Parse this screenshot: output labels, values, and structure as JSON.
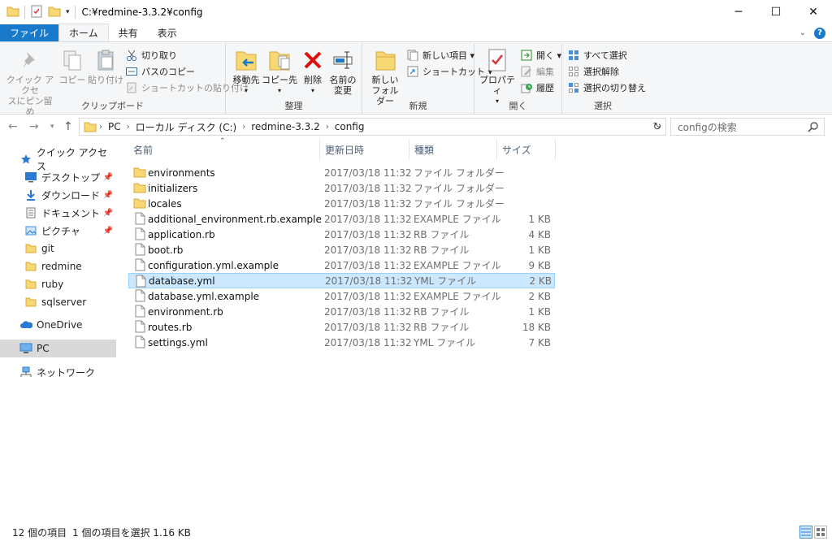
{
  "window": {
    "title": "C:¥redmine-3.3.2¥config",
    "minimize_label": "─",
    "maximize_label": "☐",
    "close_label": "✕"
  },
  "ribbon_tabs": [
    {
      "label": "ファイル"
    },
    {
      "label": "ホーム"
    },
    {
      "label": "共有"
    },
    {
      "label": "表示"
    }
  ],
  "ribbon": {
    "clipboard": {
      "label": "クリップボード",
      "pin_line1": "クイック アクセ",
      "pin_line2": "スにピン留め",
      "copy": "コピー",
      "paste": "貼り付け",
      "cut": "切り取り",
      "copy_path": "パスのコピー",
      "paste_shortcut": "ショートカットの貼り付け"
    },
    "organize": {
      "label": "整理",
      "move_to": "移動先",
      "copy_to": "コピー先",
      "delete": "削除",
      "rename_line1": "名前の",
      "rename_line2": "変更"
    },
    "new": {
      "label": "新規",
      "new_folder_line1": "新しい",
      "new_folder_line2": "フォルダー",
      "new_item": "新しい項目 ▾",
      "shortcut": "ショートカット ▾"
    },
    "open": {
      "label": "開く",
      "properties": "プロパティ",
      "open": "開く ▾",
      "edit": "編集",
      "history": "履歴"
    },
    "select": {
      "label": "選択",
      "select_all": "すべて選択",
      "select_none": "選択解除",
      "invert": "選択の切り替え"
    }
  },
  "address": {
    "crumbs": [
      "PC",
      "ローカル ディスク (C:)",
      "redmine-3.3.2",
      "config"
    ],
    "search_placeholder": "configの検索"
  },
  "nav": {
    "quick_access": "クイック アクセス",
    "items": [
      {
        "label": "デスクトップ",
        "pinned": true
      },
      {
        "label": "ダウンロード",
        "pinned": true
      },
      {
        "label": "ドキュメント",
        "pinned": true
      },
      {
        "label": "ピクチャ",
        "pinned": true
      },
      {
        "label": "git",
        "pinned": false
      },
      {
        "label": "redmine",
        "pinned": false
      },
      {
        "label": "ruby",
        "pinned": false
      },
      {
        "label": "sqlserver",
        "pinned": false
      }
    ],
    "onedrive": "OneDrive",
    "pc": "PC",
    "network": "ネットワーク"
  },
  "columns": {
    "name": "名前",
    "date": "更新日時",
    "type": "種類",
    "size": "サイズ"
  },
  "files": [
    {
      "name": "environments",
      "date": "2017/03/18 11:32",
      "type": "ファイル フォルダー",
      "size": "",
      "kind": "folder"
    },
    {
      "name": "initializers",
      "date": "2017/03/18 11:32",
      "type": "ファイル フォルダー",
      "size": "",
      "kind": "folder"
    },
    {
      "name": "locales",
      "date": "2017/03/18 11:32",
      "type": "ファイル フォルダー",
      "size": "",
      "kind": "folder"
    },
    {
      "name": "additional_environment.rb.example",
      "date": "2017/03/18 11:32",
      "type": "EXAMPLE ファイル",
      "size": "1 KB",
      "kind": "file"
    },
    {
      "name": "application.rb",
      "date": "2017/03/18 11:32",
      "type": "RB ファイル",
      "size": "4 KB",
      "kind": "file"
    },
    {
      "name": "boot.rb",
      "date": "2017/03/18 11:32",
      "type": "RB ファイル",
      "size": "1 KB",
      "kind": "file"
    },
    {
      "name": "configuration.yml.example",
      "date": "2017/03/18 11:32",
      "type": "EXAMPLE ファイル",
      "size": "9 KB",
      "kind": "file"
    },
    {
      "name": "database.yml",
      "date": "2017/03/18 11:32",
      "type": "YML ファイル",
      "size": "2 KB",
      "kind": "file",
      "selected": true
    },
    {
      "name": "database.yml.example",
      "date": "2017/03/18 11:32",
      "type": "EXAMPLE ファイル",
      "size": "2 KB",
      "kind": "file"
    },
    {
      "name": "environment.rb",
      "date": "2017/03/18 11:32",
      "type": "RB ファイル",
      "size": "1 KB",
      "kind": "file"
    },
    {
      "name": "routes.rb",
      "date": "2017/03/18 11:32",
      "type": "RB ファイル",
      "size": "18 KB",
      "kind": "file"
    },
    {
      "name": "settings.yml",
      "date": "2017/03/18 11:32",
      "type": "YML ファイル",
      "size": "7 KB",
      "kind": "file"
    }
  ],
  "status": {
    "count": "12 個の項目",
    "selection": "1 個の項目を選択  1.16 KB"
  },
  "colors": {
    "accent": "#1979ca",
    "selection": "#cce8ff",
    "folder": "#f8d775"
  }
}
